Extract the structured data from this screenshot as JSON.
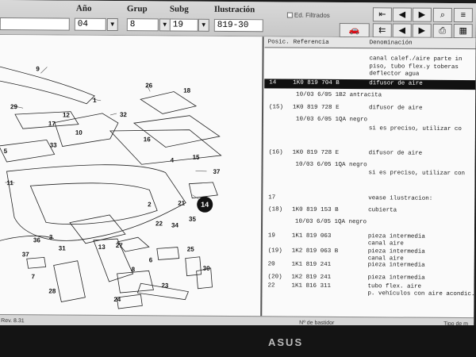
{
  "toolbar": {
    "ano_label": "Año",
    "ano_value": "04",
    "grup_label": "Grup",
    "grup_value": "8",
    "subg_label": "Subg",
    "subg_value": "19",
    "illus_label": "Ilustración",
    "illus_value": "819-30",
    "checkbox_label": "Ed. Filtrados"
  },
  "diagram": {
    "callouts": [
      "9",
      "1",
      "26",
      "18",
      "29",
      "12",
      "32",
      "17",
      "10",
      "16",
      "15",
      "33",
      "5",
      "4",
      "11",
      "37",
      "14",
      "21",
      "22",
      "34",
      "35",
      "2",
      "3",
      "27",
      "36",
      "37",
      "31",
      "13",
      "25",
      "6",
      "7",
      "8",
      "30",
      "24",
      "23",
      "28"
    ],
    "highlighted": "14"
  },
  "list": {
    "headers": {
      "pos": "Posic.",
      "ref": "Referencia",
      "den": "Denominación"
    },
    "rows": [
      {
        "pos": "",
        "ref": "",
        "den": "canal calef./aire parte in"
      },
      {
        "pos": "",
        "ref": "",
        "den": "piso, tubo flex.y toberas"
      },
      {
        "pos": "",
        "ref": "",
        "den": "deflector agua"
      },
      {
        "pos": "14",
        "ref": "1K0 819 704 B",
        "den": "difusor de aire",
        "selected": true
      },
      {
        "pos": "",
        "ref": "10/03   6/05 1B2 antracita",
        "den": ""
      },
      {
        "pos": "(15)",
        "ref": "1K0 819 728 E",
        "den": "difusor de aire"
      },
      {
        "pos": "",
        "ref": "10/03   6/05 1QA negro",
        "den": ""
      },
      {
        "pos": "",
        "ref": "",
        "den": "si es preciso, utilizar co"
      },
      {
        "pos": "(16)",
        "ref": "1K0 819 728 E",
        "den": "difusor de aire"
      },
      {
        "pos": "",
        "ref": "10/03   6/05 1QA negro",
        "den": ""
      },
      {
        "pos": "",
        "ref": "",
        "den": "si es preciso, utilizar con"
      },
      {
        "pos": "17",
        "ref": "",
        "den": "vease ilustracion:"
      },
      {
        "pos": "(18)",
        "ref": "1K0 819 153 B",
        "den": "cubierta"
      },
      {
        "pos": "",
        "ref": "10/03   6/05 1QA negro",
        "den": ""
      },
      {
        "pos": "19",
        "ref": "1K1 819 063",
        "den": "pieza intermedia"
      },
      {
        "pos": "",
        "ref": "",
        "den": "canal aire"
      },
      {
        "pos": "(19)",
        "ref": "1K2 819 063 B",
        "den": "pieza intermedia"
      },
      {
        "pos": "",
        "ref": "",
        "den": "canal aire"
      },
      {
        "pos": "20",
        "ref": "1K1 819 241",
        "den": "pieza intermedia"
      },
      {
        "pos": "(20)",
        "ref": "1K2 819 241",
        "den": "pieza intermedia"
      },
      {
        "pos": "22",
        "ref": "1K1 816 311",
        "den": "tubo flex. aire"
      },
      {
        "pos": "",
        "ref": "",
        "den": "p. vehículos con aire acondic."
      }
    ]
  },
  "statusbar": {
    "left": "Rev. 8.31",
    "mid": "Nº de bastidor",
    "right": "Tipo de m"
  },
  "monitor": {
    "brand": "ASUS"
  },
  "colors": {
    "selection": "#111111",
    "background": "#f2f2f2"
  }
}
